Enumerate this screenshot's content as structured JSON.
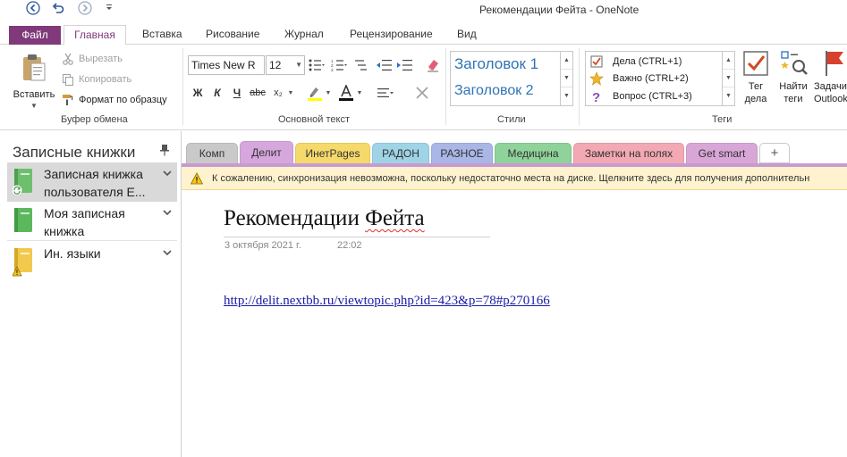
{
  "window": {
    "title": "Рекомендации Фейта - OneNote",
    "qat": {
      "back_icon": "back-arrow-icon",
      "undo_icon": "undo-icon",
      "forward_icon": "forward-arrow-icon",
      "more_icon": "customize-qat-icon"
    }
  },
  "ribbon_tabs": [
    {
      "label": "Файл"
    },
    {
      "label": "Главная"
    },
    {
      "label": "Вставка"
    },
    {
      "label": "Рисование"
    },
    {
      "label": "Журнал"
    },
    {
      "label": "Рецензирование"
    },
    {
      "label": "Вид"
    }
  ],
  "clipboard": {
    "group_label": "Буфер обмена",
    "paste_label": "Вставить",
    "cut_label": "Вырезать",
    "copy_label": "Копировать",
    "format_painter_label": "Формат по образцу"
  },
  "basic_text": {
    "group_label": "Основной текст",
    "font_name": "Times New R",
    "font_size": "12",
    "bold": "Ж",
    "italic": "К",
    "underline": "Ч",
    "strike": "abc",
    "subscript": "x₂"
  },
  "styles": {
    "group_label": "Стили",
    "items": [
      "Заголовок 1",
      "Заголовок 2"
    ]
  },
  "tags": {
    "group_label": "Теги",
    "items": [
      {
        "label": "Дела (CTRL+1)",
        "icon": "checkbox-icon"
      },
      {
        "label": "Важно (CTRL+2)",
        "icon": "star-icon"
      },
      {
        "label": "Вопрос (CTRL+3)",
        "icon": "question-icon"
      }
    ],
    "tag_todo": {
      "line1": "Тег",
      "line2": "дела"
    },
    "find_tags": {
      "line1": "Найти",
      "line2": "теги"
    },
    "outlook_tasks": {
      "line1": "Задачи",
      "line2": "Outlook"
    }
  },
  "nav": {
    "title": "Записные книжки",
    "notebooks": [
      {
        "label": "Записная книжка пользователя E...",
        "color": "#6dbf6d",
        "selected": true
      },
      {
        "label": "Моя записная книжка",
        "color": "#5cb85c",
        "selected": false
      },
      {
        "label": "Ин. языки",
        "color": "#f2c94c",
        "selected": false
      }
    ]
  },
  "sections": [
    {
      "label": "Комп",
      "color": "#c9c9c9"
    },
    {
      "label": "Делит",
      "color": "#d5a7dc"
    },
    {
      "label": "ИнетPages",
      "color": "#f5d96b"
    },
    {
      "label": "РАДОН",
      "color": "#9fd3e6"
    },
    {
      "label": "РАЗНОЕ",
      "color": "#a9b6e6"
    },
    {
      "label": "Медицина",
      "color": "#8fd39a"
    },
    {
      "label": "Заметки на полях",
      "color": "#f2a9b3"
    },
    {
      "label": "Get smart",
      "color": "#d9a6d8"
    },
    {
      "label": "+",
      "color": "#ffffff"
    }
  ],
  "infobar": {
    "text": "К сожалению, синхронизация невозможна, поскольку недостаточно места на диске. Щелкните здесь для получения дополнительн"
  },
  "page": {
    "title": "Рекомендации Фейта",
    "date": "3 октября 2021 г.",
    "time": "22:02",
    "link": "http://delit.nextbb.ru/viewtopic.php?id=423&p=78#p270166"
  }
}
